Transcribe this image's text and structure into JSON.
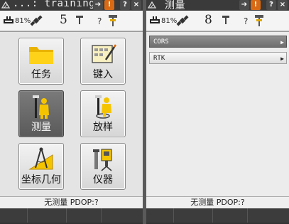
{
  "left": {
    "title": "...: training",
    "title_buttons": {
      "arrow": "➔",
      "warn": "!",
      "help": "?",
      "close": "×"
    },
    "status": {
      "battery_pct": "81%",
      "satellites": "5",
      "unknown": "?"
    },
    "tiles": [
      {
        "label": "任务",
        "icon": "folder-icon"
      },
      {
        "label": "键入",
        "icon": "keypad-entry-icon"
      },
      {
        "label": "测量",
        "icon": "survey-worker-icon",
        "selected": true
      },
      {
        "label": "放样",
        "icon": "stakeout-worker-icon"
      },
      {
        "label": "坐标几何",
        "icon": "cogo-compass-icon"
      },
      {
        "label": "仪器",
        "icon": "instrument-icon"
      }
    ],
    "bottom_status": "无测量  PDOP:?"
  },
  "right": {
    "title": "测量",
    "title_buttons": {
      "arrow": "➔",
      "warn": "!",
      "help": "?",
      "close": "×"
    },
    "status": {
      "battery_pct": "81%",
      "satellites": "8",
      "unknown": "?"
    },
    "menu": [
      {
        "label": "CORS",
        "active": true
      },
      {
        "label": "RTK",
        "active": false
      }
    ],
    "bottom_status": "无测量  PDOP:?"
  },
  "colors": {
    "titlebar": "#3a3a3a",
    "warning": "#d86a15",
    "screen_bg": "#d9d9d9",
    "accent_yellow": "#f5c400"
  }
}
